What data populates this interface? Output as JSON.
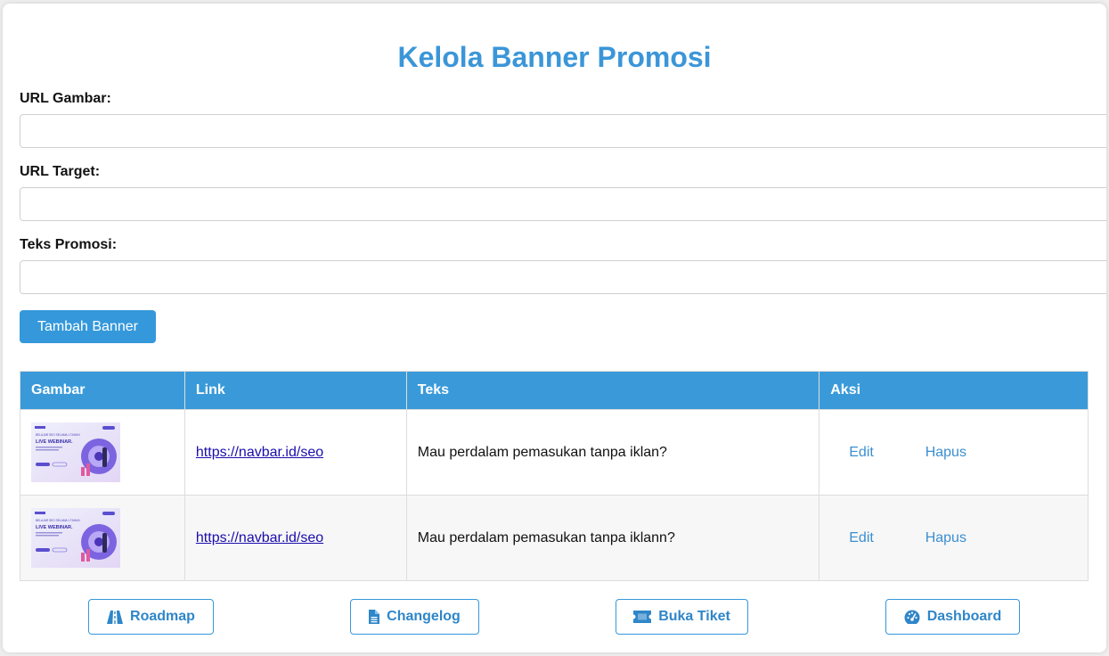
{
  "page": {
    "title": "Kelola Banner Promosi"
  },
  "form": {
    "url_gambar_label": "URL Gambar:",
    "url_gambar_value": "",
    "url_target_label": "URL Target:",
    "url_target_value": "",
    "teks_promosi_label": "Teks Promosi:",
    "teks_promosi_value": "",
    "submit_label": "Tambah Banner"
  },
  "table": {
    "headers": [
      "Gambar",
      "Link",
      "Teks",
      "Aksi"
    ],
    "rows": [
      {
        "image_text": {
          "heading": "LIVE WEBINAR.",
          "tagline": "BELAJAR SEO SELAMA 1 TAHUN"
        },
        "link": "https://navbar.id/seo",
        "teks": "Mau perdalam pemasukan tanpa iklan?",
        "edit_label": "Edit",
        "hapus_label": "Hapus"
      },
      {
        "image_text": {
          "heading": "LIVE WEBINAR.",
          "tagline": "BELAJAR SEO SELAMA 1 TAHUN"
        },
        "link": "https://navbar.id/seo",
        "teks": "Mau perdalam pemasukan tanpa iklann?",
        "edit_label": "Edit",
        "hapus_label": "Hapus"
      }
    ]
  },
  "footer_nav": {
    "roadmap": {
      "label": "Roadmap",
      "icon": "road-icon"
    },
    "changelog": {
      "label": "Changelog",
      "icon": "file-icon"
    },
    "tiket": {
      "label": "Buka Tiket",
      "icon": "ticket-icon"
    },
    "dashboard": {
      "label": "Dashboard",
      "icon": "gauge-icon"
    }
  },
  "colors": {
    "accent": "#3498db",
    "title": "#3b96d8",
    "header_bg": "#3a9ad9",
    "action_link": "#3b8fd0"
  }
}
